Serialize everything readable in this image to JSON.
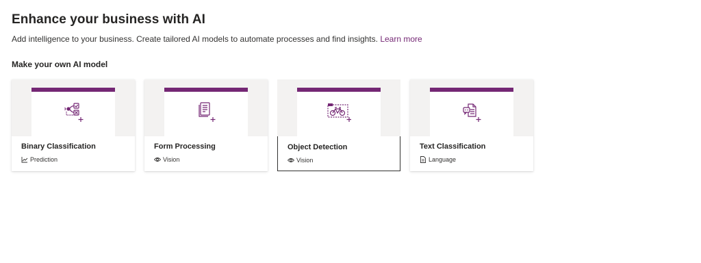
{
  "header": {
    "title": "Enhance your business with AI",
    "description": "Add intelligence to your business. Create tailored AI models to automate processes and find insights.",
    "learn_more": "Learn more"
  },
  "section": {
    "title": "Make your own AI model"
  },
  "models": [
    {
      "name": "Binary Classification",
      "category": "Prediction",
      "category_icon": "trend-chart-icon",
      "icon": "binary-classification-icon"
    },
    {
      "name": "Form Processing",
      "category": "Vision",
      "category_icon": "eye-icon",
      "icon": "form-processing-icon"
    },
    {
      "name": "Object Detection",
      "category": "Vision",
      "category_icon": "eye-icon",
      "icon": "object-detection-icon",
      "selected": true
    },
    {
      "name": "Text Classification",
      "category": "Language",
      "category_icon": "document-icon",
      "icon": "text-classification-icon"
    }
  ],
  "colors": {
    "accent": "#742774",
    "hero_bg": "#f3f2f1",
    "text": "#252423"
  }
}
